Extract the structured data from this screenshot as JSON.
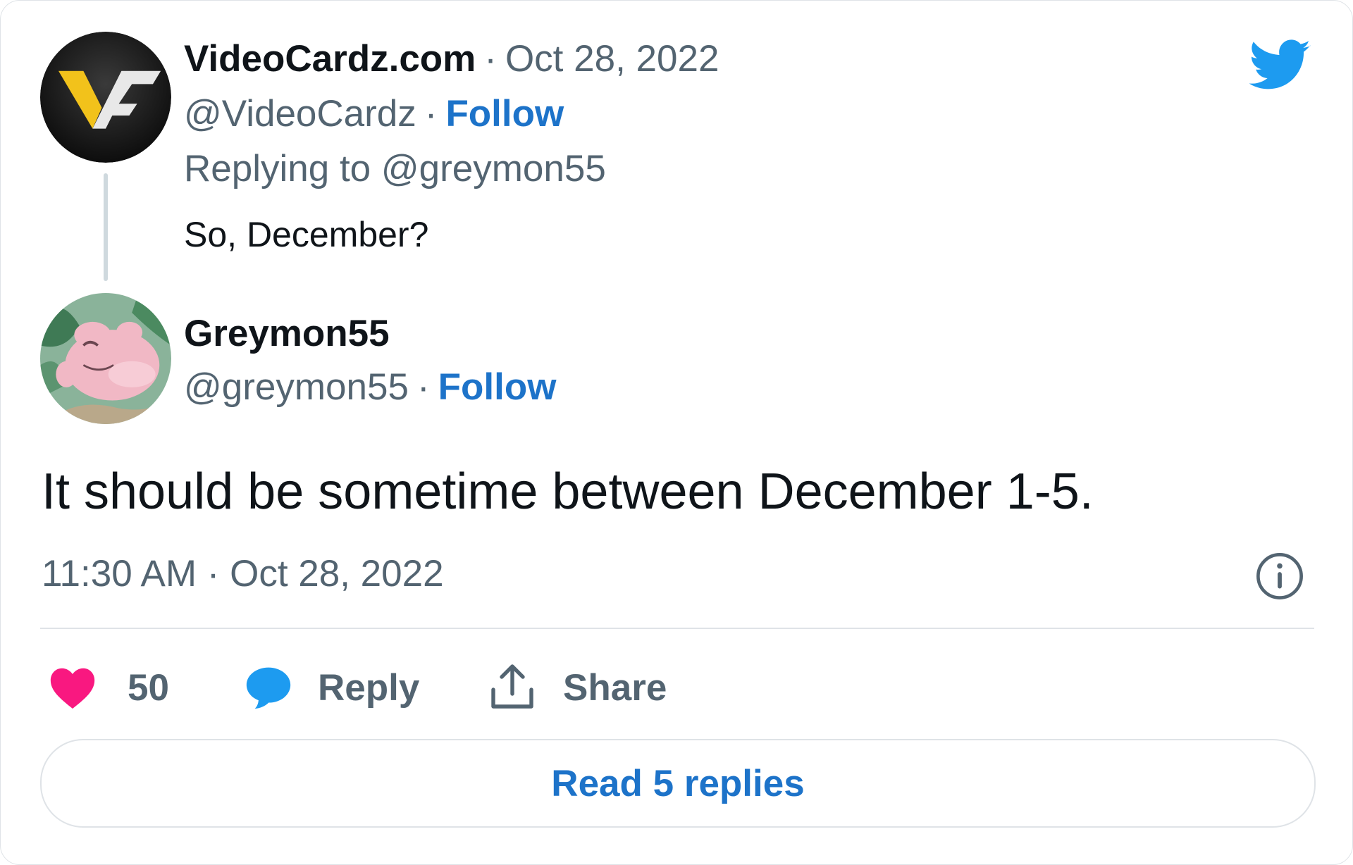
{
  "reply_tweet": {
    "display_name": "VideoCardz.com",
    "date": "Oct 28, 2022",
    "handle": "@VideoCardz",
    "follow_label": "Follow",
    "replying_to": "Replying to @greymon55",
    "text": "So, December?",
    "avatar_icon": "videocardz-logo-icon"
  },
  "main_tweet": {
    "display_name": "Greymon55",
    "handle": "@greymon55",
    "follow_label": "Follow",
    "text": "It should be sometime between December 1-5.",
    "timestamp": "11:30 AM · Oct 28, 2022",
    "avatar_icon": "greymon-avatar-icon"
  },
  "separator": "·",
  "actions": {
    "like_count": "50",
    "reply_label": "Reply",
    "share_label": "Share"
  },
  "read_replies_label": "Read 5 replies",
  "colors": {
    "accent": "#1d73c9",
    "twitter_blue": "#1d9bf0",
    "like_pink": "#f91880",
    "muted_text": "#536471",
    "border": "#dfe3e7"
  }
}
